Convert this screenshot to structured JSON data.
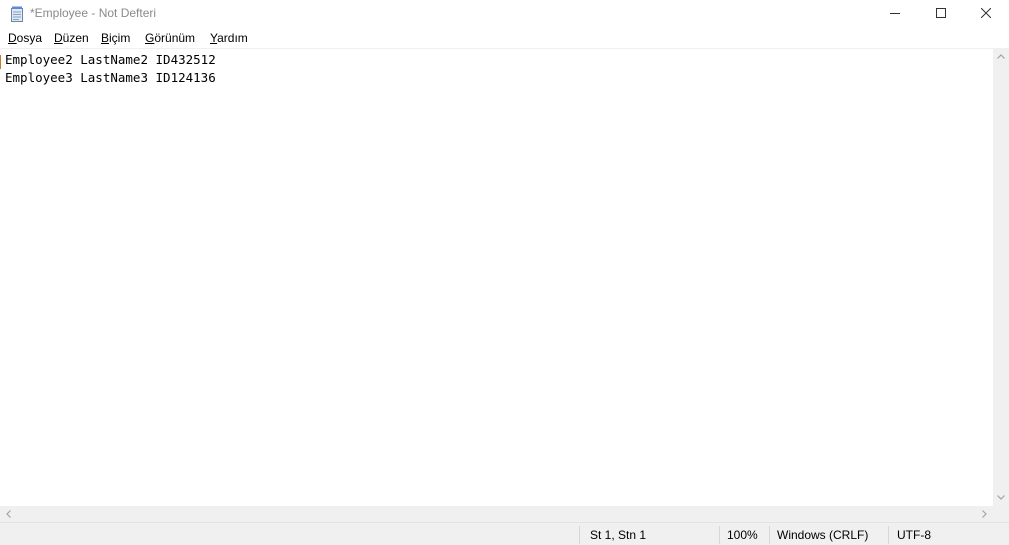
{
  "window": {
    "title": "*Employee - Not Defteri",
    "icon": "notepad-icon"
  },
  "menu": {
    "items": [
      {
        "accel": "D",
        "rest": "osya"
      },
      {
        "accel": "D",
        "rest": "üzen"
      },
      {
        "accel": "B",
        "rest": "içim"
      },
      {
        "accel": "G",
        "rest": "örünüm"
      },
      {
        "accel": "Y",
        "rest": "ardım"
      }
    ]
  },
  "editor": {
    "lines": [
      "Employee2 LastName2 ID432512",
      "Employee3 LastName3 ID124136"
    ]
  },
  "status": {
    "position": "St 1, Stn 1",
    "zoom": "100%",
    "line_ending": "Windows (CRLF)",
    "encoding": "UTF-8"
  }
}
